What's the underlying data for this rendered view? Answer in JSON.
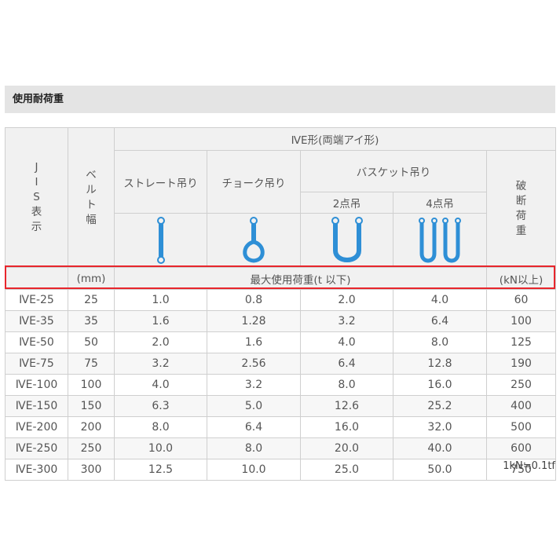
{
  "section_title": "使用耐荷重",
  "header": {
    "jis_chars": [
      "J",
      "I",
      "S",
      "表",
      "示"
    ],
    "width_chars": [
      "ベ",
      "ル",
      "ト",
      "幅"
    ],
    "width_unit": "(mm)",
    "group_title": "ⅣE形(両端アイ形)",
    "straight_label": "ストレート吊り",
    "choke_label": "チョーク吊り",
    "basket_label": "バスケット吊り",
    "basket_2": "2点吊",
    "basket_4": "4点吊",
    "break_chars": [
      "破",
      "断",
      "荷",
      "重"
    ],
    "max_load_label": "最大使用荷重(t 以下)",
    "break_unit": "(kN以上)"
  },
  "icons": {
    "straight": "straight-sling-icon",
    "choke": "choke-sling-icon",
    "basket2": "basket-2point-sling-icon",
    "basket4": "basket-4point-sling-icon"
  },
  "colors": {
    "sling_blue": "#2e8fd6",
    "highlight_red": "#e8262c"
  },
  "rows": [
    {
      "model": "ⅣE-25",
      "width": "25",
      "straight": "1.0",
      "choke": "0.8",
      "basket2": "2.0",
      "basket4": "4.0",
      "break": "60"
    },
    {
      "model": "ⅣE-35",
      "width": "35",
      "straight": "1.6",
      "choke": "1.28",
      "basket2": "3.2",
      "basket4": "6.4",
      "break": "100"
    },
    {
      "model": "ⅣE-50",
      "width": "50",
      "straight": "2.0",
      "choke": "1.6",
      "basket2": "4.0",
      "basket4": "8.0",
      "break": "125"
    },
    {
      "model": "ⅣE-75",
      "width": "75",
      "straight": "3.2",
      "choke": "2.56",
      "basket2": "6.4",
      "basket4": "12.8",
      "break": "190"
    },
    {
      "model": "ⅣE-100",
      "width": "100",
      "straight": "4.0",
      "choke": "3.2",
      "basket2": "8.0",
      "basket4": "16.0",
      "break": "250"
    },
    {
      "model": "ⅣE-150",
      "width": "150",
      "straight": "6.3",
      "choke": "5.0",
      "basket2": "12.6",
      "basket4": "25.2",
      "break": "400"
    },
    {
      "model": "ⅣE-200",
      "width": "200",
      "straight": "8.0",
      "choke": "6.4",
      "basket2": "16.0",
      "basket4": "32.0",
      "break": "500"
    },
    {
      "model": "ⅣE-250",
      "width": "250",
      "straight": "10.0",
      "choke": "8.0",
      "basket2": "20.0",
      "basket4": "40.0",
      "break": "600"
    },
    {
      "model": "ⅣE-300",
      "width": "300",
      "straight": "12.5",
      "choke": "10.0",
      "basket2": "25.0",
      "basket4": "50.0",
      "break": "750"
    }
  ],
  "footnote": "1kN≒0.1tf"
}
